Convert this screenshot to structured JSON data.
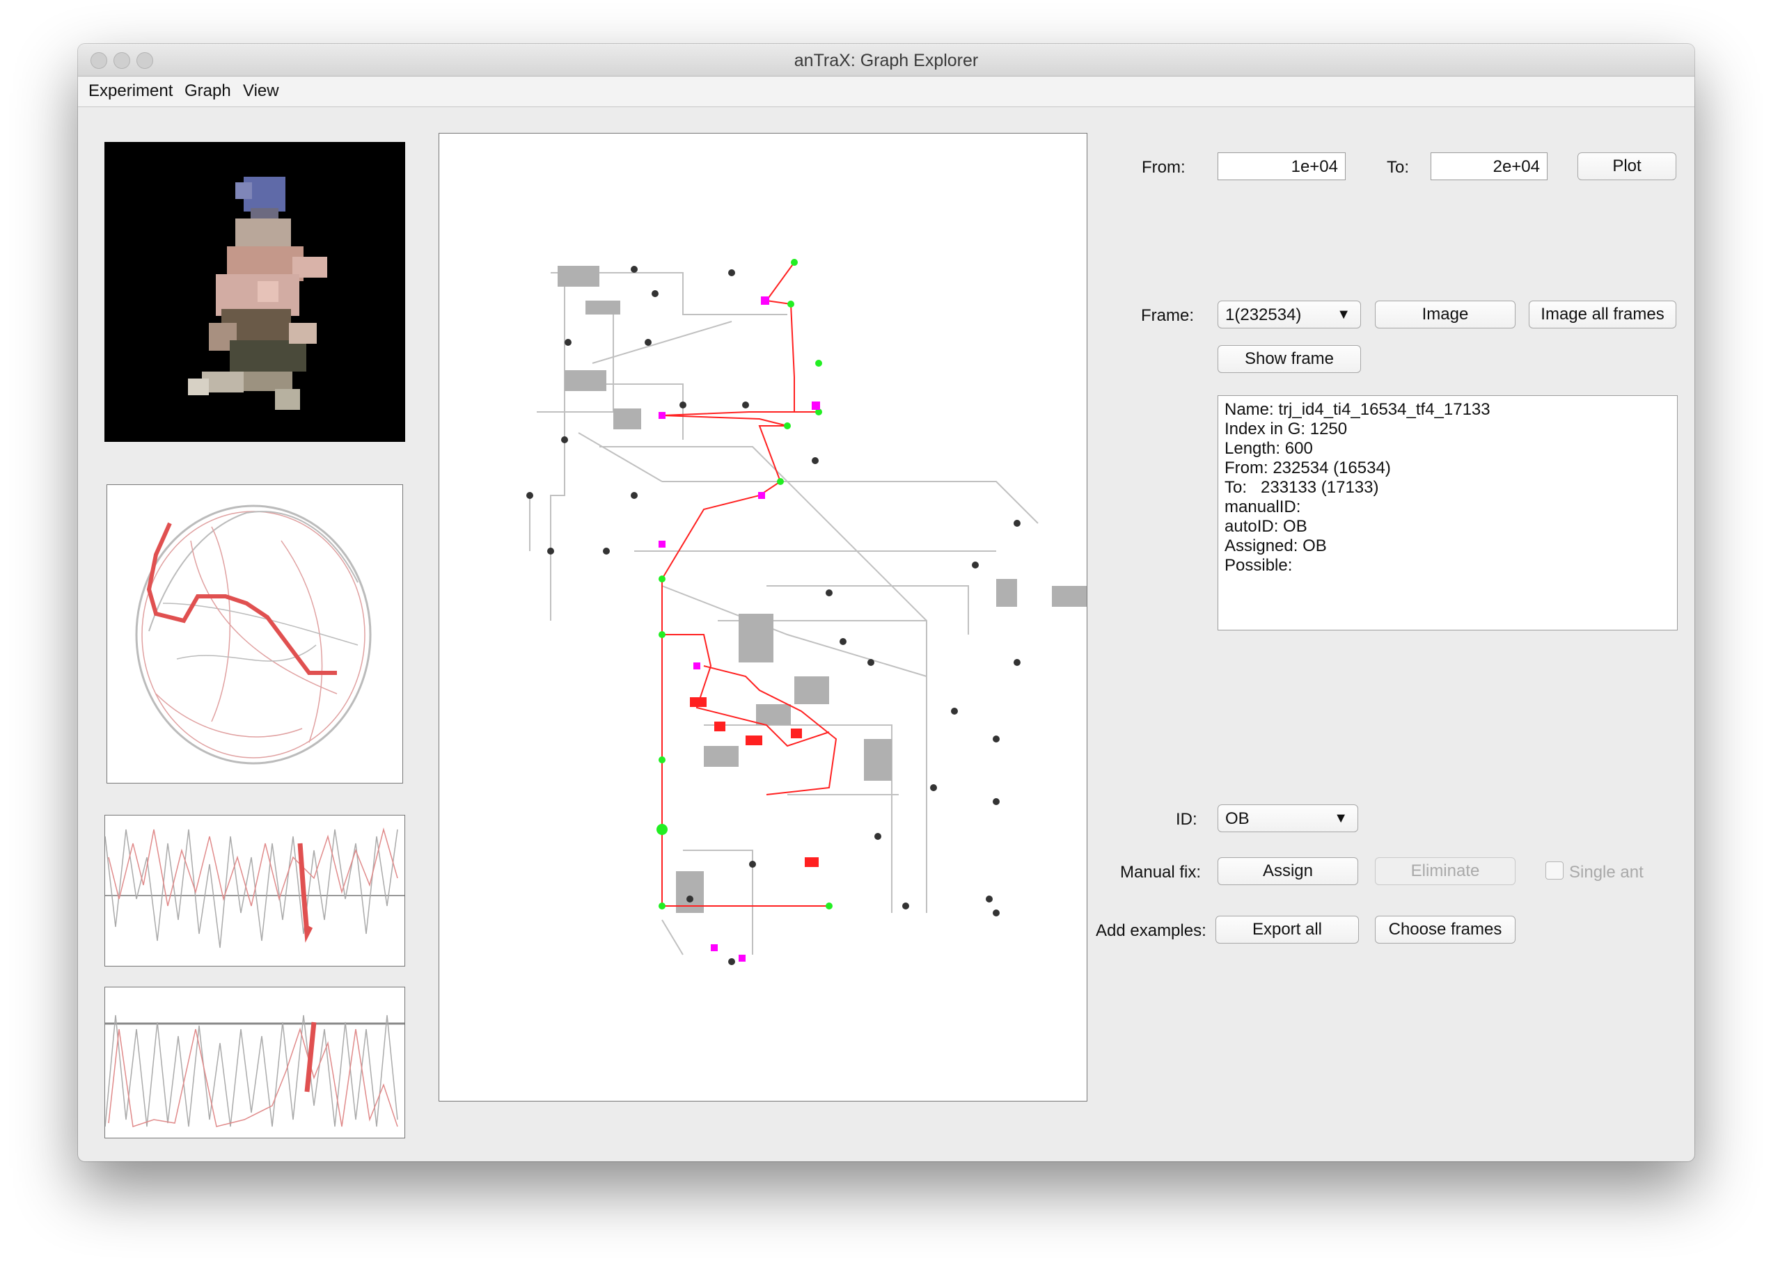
{
  "window": {
    "title": "anTraX: Graph Explorer"
  },
  "menu": [
    "Experiment",
    "Graph",
    "View"
  ],
  "range": {
    "from_label": "From:",
    "from_value": "1e+04",
    "to_label": "To:",
    "to_value": "2e+04",
    "plot_label": "Plot"
  },
  "frame": {
    "label": "Frame:",
    "selected": "1(232534)",
    "image_label": "Image",
    "image_all_label": "Image all frames",
    "show_frame_label": "Show frame"
  },
  "info": {
    "lines": [
      "Name: trj_id4_ti4_16534_tf4_17133",
      "Index in G: 1250",
      "Length: 600",
      "From: 232534 (16534)",
      "To:   233133 (17133)",
      "manualID:",
      "autoID: OB",
      "Assigned: OB",
      "Possible:"
    ]
  },
  "id": {
    "label": "ID:",
    "selected": "OB"
  },
  "manual_fix": {
    "label": "Manual fix:",
    "assign_label": "Assign",
    "eliminate_label": "Eliminate",
    "single_ant_label": "Single ant"
  },
  "examples": {
    "label": "Add examples:",
    "export_label": "Export all",
    "choose_label": "Choose frames"
  },
  "colors": {
    "highlight_path": "#ff2020",
    "node_green": "#22ee22",
    "node_magenta": "#ff00ff",
    "node_dark": "#333333",
    "graph_gray": "#b3b3b3"
  },
  "icons": [
    "close-light-icon",
    "minimize-light-icon",
    "zoom-light-icon",
    "dropdown-caret-icon",
    "checkbox-icon"
  ]
}
